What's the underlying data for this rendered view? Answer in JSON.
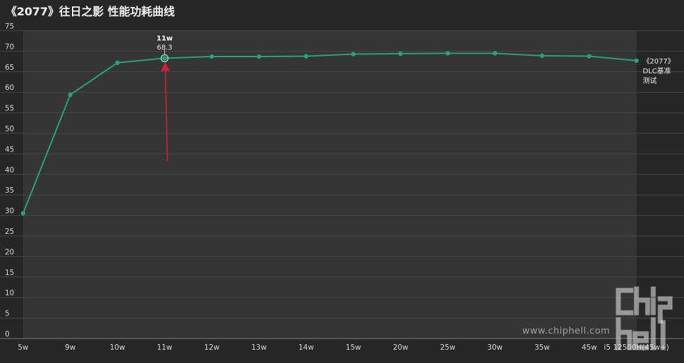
{
  "title": "《2077》往日之影 性能功耗曲线",
  "chart_data": {
    "type": "line",
    "categories": [
      "5w",
      "9w",
      "10w",
      "11w",
      "12w",
      "13w",
      "14w",
      "15w",
      "20w",
      "25w",
      "30w",
      "35w",
      "45w",
      "i5 12500H(45w+)"
    ],
    "series": [
      {
        "name": "《2077》DLC基准测试",
        "name_lines": [
          "《2077》",
          "DLC基准",
          "测试"
        ],
        "values": [
          30.5,
          59.4,
          67.2,
          68.3,
          68.7,
          68.7,
          68.8,
          69.3,
          69.4,
          69.5,
          69.5,
          68.9,
          68.8,
          67.7
        ]
      }
    ],
    "ylim": [
      0,
      75
    ],
    "yticks": [
      0,
      5,
      10,
      15,
      20,
      25,
      30,
      35,
      40,
      45,
      50,
      55,
      60,
      65,
      70,
      75
    ],
    "xlabel": "",
    "ylabel": "",
    "grid": true,
    "highlight": {
      "category": "11w",
      "value_label": "68.3",
      "annotation": "red arrow pointing up to highlighted point"
    },
    "colors": {
      "line": "#27a17e",
      "background": "#262626",
      "plot_area": "#353535",
      "grid": "#474747",
      "arrow": "#d0203a"
    }
  },
  "watermark": {
    "url": "www.chiphell.com",
    "logo": "chip hell logo"
  }
}
